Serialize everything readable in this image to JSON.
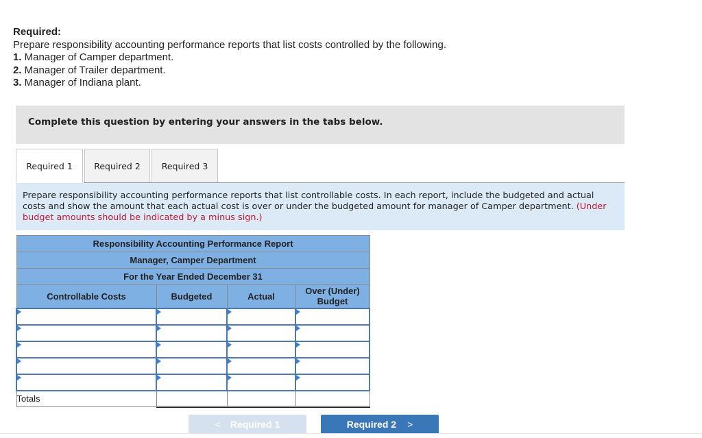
{
  "required": {
    "heading": "Required:",
    "intro": "Prepare responsibility accounting performance reports that list costs controlled by the following.",
    "items": [
      {
        "num": "1.",
        "text": " Manager of Camper department."
      },
      {
        "num": "2.",
        "text": " Manager of Trailer department."
      },
      {
        "num": "3.",
        "text": " Manager of Indiana plant."
      }
    ]
  },
  "instruction": "Complete this question by entering your answers in the tabs below.",
  "tabs": [
    {
      "label": "Required 1",
      "active": true
    },
    {
      "label": "Required 2",
      "active": false
    },
    {
      "label": "Required 3",
      "active": false
    }
  ],
  "prompt": {
    "text": "Prepare responsibility accounting performance reports that list controllable costs. In each report, include the budgeted and actual costs and show the amount that each actual cost is over or under the budgeted amount for manager of Camper department.",
    "note": "(Under budget amounts should be indicated by a minus sign.)"
  },
  "report": {
    "title": "Responsibility Accounting Performance Report",
    "subtitle": "Manager, Camper Department",
    "period": "For the Year Ended December 31",
    "columns": [
      "Controllable Costs",
      "Budgeted",
      "Actual",
      "Over (Under) Budget"
    ],
    "rows": [
      [
        "",
        "",
        "",
        ""
      ],
      [
        "",
        "",
        "",
        ""
      ],
      [
        "",
        "",
        "",
        ""
      ],
      [
        "",
        "",
        "",
        ""
      ],
      [
        "",
        "",
        "",
        ""
      ]
    ],
    "totals_label": "Totals",
    "totals": [
      "",
      "",
      ""
    ]
  },
  "navigation": {
    "prev_label": "Required 1",
    "next_label": "Required 2",
    "prev_icon": "chevron-left-icon",
    "next_icon": "chevron-right-icon"
  }
}
